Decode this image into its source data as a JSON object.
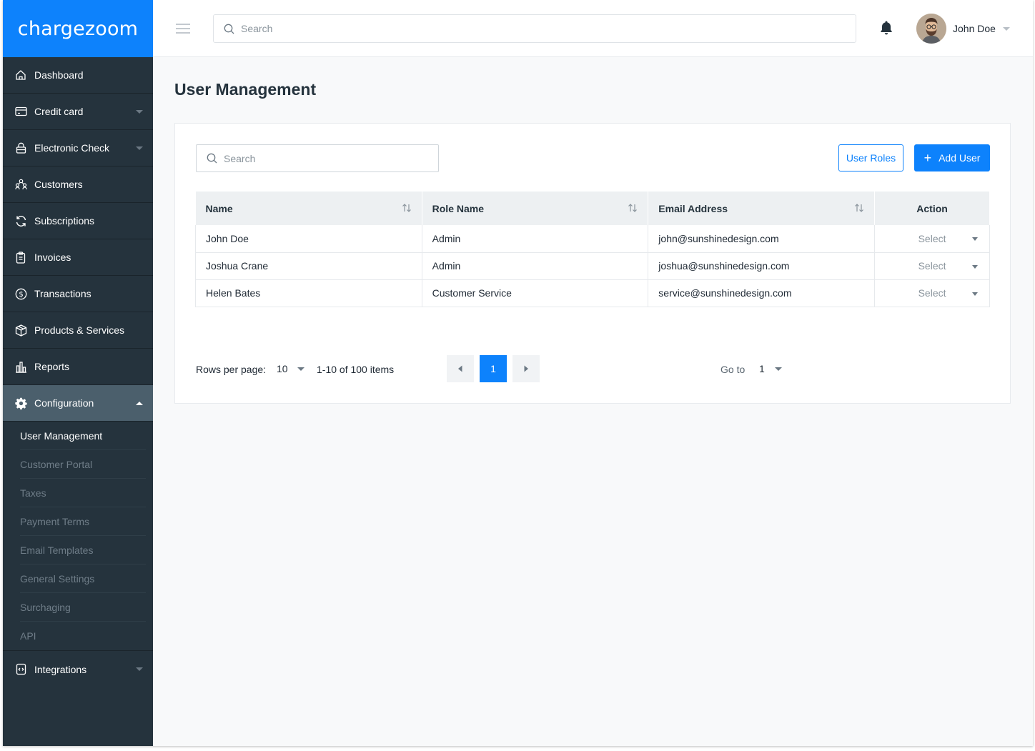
{
  "app": {
    "logo_text": "chargezoom",
    "brand_color": "#0d82fc",
    "sidebar_color": "#25333d"
  },
  "sidebar": {
    "items": [
      {
        "label": "Dashboard",
        "icon": "home-icon"
      },
      {
        "label": "Credit card",
        "icon": "credit-card-icon"
      },
      {
        "label": "Electronic Check",
        "icon": "lock-icon"
      },
      {
        "label": "Customers",
        "icon": "customers-icon"
      },
      {
        "label": "Subscriptions",
        "icon": "refresh-icon"
      },
      {
        "label": "Invoices",
        "icon": "clipboard-icon"
      },
      {
        "label": "Transactions",
        "icon": "dollar-coin-icon"
      },
      {
        "label": "Products & Services",
        "icon": "box-icon"
      },
      {
        "label": "Reports",
        "icon": "bar-chart-icon"
      },
      {
        "label": "Configuration",
        "icon": "gear-icon"
      }
    ],
    "config_sub": [
      "User Management",
      "Customer Portal",
      "Taxes",
      "Payment Terms",
      "Email Templates",
      "General Settings",
      "Surchaging",
      "API"
    ],
    "integrations": {
      "label": "Integrations",
      "icon": "code-file-icon"
    }
  },
  "header": {
    "search_placeholder": "Search",
    "user_name": "John Doe"
  },
  "main": {
    "title": "User Management",
    "search_placeholder": "Search",
    "user_roles_label": "User Roles",
    "add_user_label": "Add User",
    "table": {
      "columns": [
        "Name",
        "Role Name",
        "Email Address",
        "Action"
      ],
      "rows": [
        {
          "name": "John Doe",
          "role": "Admin",
          "email": "john@sunshinedesign.com",
          "action": "Select"
        },
        {
          "name": "Joshua Crane",
          "role": "Admin",
          "email": "joshua@sunshinedesign.com",
          "action": "Select"
        },
        {
          "name": "Helen Bates",
          "role": "Customer Service",
          "email": "service@sunshinedesign.com",
          "action": "Select"
        }
      ]
    },
    "pagination": {
      "rows_per_page_label": "Rows per page:",
      "rows_per_page": "10",
      "items_text": "1-10 of 100 items",
      "current_page": "1",
      "goto_label": "Go to",
      "goto_value": "1"
    }
  }
}
